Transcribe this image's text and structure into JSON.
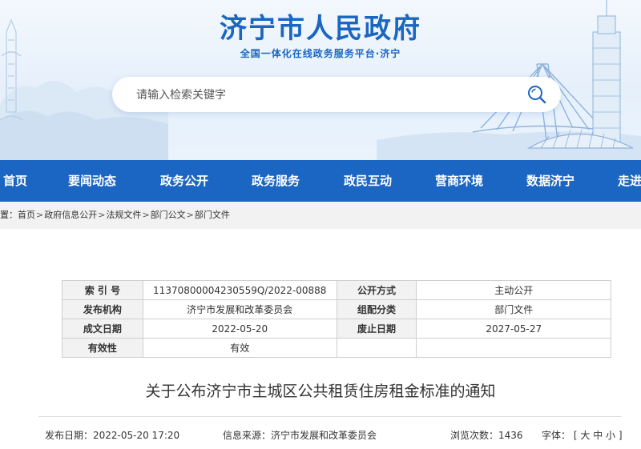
{
  "header": {
    "site_title": "济宁市人民政府",
    "subtitle": "全国一体化在线政务服务平台·济宁",
    "search_placeholder": "请输入检索关键字"
  },
  "nav": [
    "首页",
    "要闻动态",
    "政务公开",
    "政务服务",
    "政民互动",
    "营商环境",
    "数据济宁",
    "走进"
  ],
  "breadcrumb": {
    "prefix": "置：",
    "items": [
      "首页",
      "政府信息公开",
      "法规文件",
      "部门公文",
      "部门文件"
    ],
    "separator": ">"
  },
  "info": {
    "index_label": "索 引 号",
    "index_value": "11370800004230559Q/2022-00888",
    "open_method_label": "公开方式",
    "open_method_value": "主动公开",
    "issuer_label": "发布机构",
    "issuer_value": "济宁市发展和改革委员会",
    "category_label": "组配分类",
    "category_value": "部门文件",
    "created_label": "成文日期",
    "created_value": "2022-05-20",
    "expiry_label": "废止日期",
    "expiry_value": "2027-05-27",
    "valid_label": "有效性",
    "valid_value": "有效"
  },
  "document": {
    "title": "关于公布济宁市主城区公共租赁住房租金标准的通知"
  },
  "meta": {
    "publish_date": "发布日期：2022-05-20 17:20",
    "source": "信息来源：济宁市发展和改革委员会",
    "views_label": "浏览次数：",
    "views": "1436",
    "font_label": "字体：",
    "font_open": "[",
    "font_large": "大",
    "font_medium": "中",
    "font_small": "小",
    "font_close": "]"
  },
  "colors": {
    "brand_blue": "#1a66c2",
    "nav_background": "#1a66c2",
    "breadcrumb_background": "#f2f2f2",
    "table_label_background": "#f2f2f2"
  },
  "icons": {
    "search": "search-icon"
  }
}
